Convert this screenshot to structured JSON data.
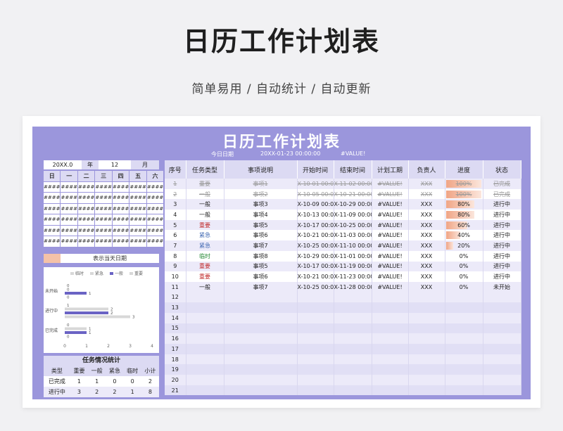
{
  "header": {
    "title": "日历工作计划表",
    "subtitle": "简单易用 / 自动统计 / 自动更新"
  },
  "sheet": {
    "title": "日历工作计划表",
    "today_label": "今日日期",
    "today_value": "20XX-01-23 00:00:00",
    "today_extra": "#VALUE!"
  },
  "calendar": {
    "year": "20XX.0",
    "year_label": "年",
    "month": "12",
    "month_label": "月",
    "weekdays": [
      "日",
      "一",
      "二",
      "三",
      "四",
      "五",
      "六"
    ],
    "cell": "####"
  },
  "legend_today": "表示当天日期",
  "chart_data": {
    "type": "bar",
    "orientation": "horizontal",
    "categories": [
      "未开始",
      "进行中",
      "已完成"
    ],
    "series": [
      {
        "name": "临时",
        "values": [
          0,
          0,
          0
        ],
        "color": "#d8d8d8"
      },
      {
        "name": "紧急",
        "values": [
          0,
          2,
          1
        ],
        "color": "#d8d8d8"
      },
      {
        "name": "一般",
        "values": [
          1,
          2,
          1
        ],
        "color": "#6a63c4"
      },
      {
        "name": "重要",
        "values": [
          0,
          3,
          0
        ],
        "color": "#d8d8d8"
      }
    ],
    "series_labels_order": [
      "临时",
      "紧急",
      "一般",
      "重要"
    ],
    "bar_labels": [
      [
        "0",
        "0",
        "1",
        "0"
      ],
      [
        "1",
        "2",
        "2",
        "3"
      ],
      [
        "0",
        "1",
        "1",
        "0"
      ]
    ],
    "xlim": [
      0,
      4
    ],
    "xticks": [
      "0",
      "1",
      "2",
      "3",
      "4"
    ]
  },
  "stats": {
    "title": "任务情况统计",
    "headers": [
      "类型",
      "重要",
      "一般",
      "紧急",
      "临时",
      "小计"
    ],
    "rows": [
      [
        "已完成",
        "1",
        "1",
        "0",
        "0",
        "2"
      ],
      [
        "进行中",
        "3",
        "2",
        "2",
        "1",
        "8"
      ]
    ]
  },
  "table": {
    "headers": [
      "序号",
      "任务类型",
      "事项说明",
      "开始时间",
      "结束时间",
      "计划工期",
      "负责人",
      "进度",
      "状态"
    ],
    "rows": [
      {
        "no": "1",
        "type": "重要",
        "desc": "事项1",
        "start": "X-10-01 00:00",
        "end": "X-11-02 00:00",
        "dur": "#VALUE!",
        "owner": "XXX",
        "prog": "100%",
        "p": 1.0,
        "status": "已完成",
        "done": true
      },
      {
        "no": "2",
        "type": "一般",
        "desc": "事项2",
        "start": "X-10-05 00:00",
        "end": "X-10-21 00:00",
        "dur": "#VALUE!",
        "owner": "XXX",
        "prog": "100%",
        "p": 1.0,
        "status": "已完成",
        "done": true
      },
      {
        "no": "3",
        "type": "一般",
        "desc": "事项3",
        "start": "X-10-09 00:00",
        "end": "X-10-29 00:00",
        "dur": "#VALUE!",
        "owner": "XXX",
        "prog": "80%",
        "p": 0.8,
        "status": "进行中"
      },
      {
        "no": "4",
        "type": "一般",
        "desc": "事项4",
        "start": "X-10-13 00:00",
        "end": "X-11-09 00:00",
        "dur": "#VALUE!",
        "owner": "XXX",
        "prog": "80%",
        "p": 0.8,
        "status": "进行中"
      },
      {
        "no": "5",
        "type": "重要",
        "desc": "事项5",
        "start": "X-10-17 00:00",
        "end": "X-10-25 00:00",
        "dur": "#VALUE!",
        "owner": "XXX",
        "prog": "60%",
        "p": 0.6,
        "status": "进行中"
      },
      {
        "no": "6",
        "type": "紧急",
        "desc": "事项6",
        "start": "X-10-21 00:00",
        "end": "X-11-03 00:00",
        "dur": "#VALUE!",
        "owner": "XXX",
        "prog": "40%",
        "p": 0.4,
        "status": "进行中"
      },
      {
        "no": "7",
        "type": "紧急",
        "desc": "事项7",
        "start": "X-10-25 00:00",
        "end": "X-11-10 00:00",
        "dur": "#VALUE!",
        "owner": "XXX",
        "prog": "20%",
        "p": 0.2,
        "status": "进行中"
      },
      {
        "no": "8",
        "type": "临时",
        "desc": "事项8",
        "start": "X-10-29 00:00",
        "end": "X-11-01 00:00",
        "dur": "#VALUE!",
        "owner": "XXX",
        "prog": "0%",
        "p": 0,
        "status": "进行中"
      },
      {
        "no": "9",
        "type": "重要",
        "desc": "事项5",
        "start": "X-10-17 00:00",
        "end": "X-11-19 00:00",
        "dur": "#VALUE!",
        "owner": "XXX",
        "prog": "0%",
        "p": 0,
        "status": "进行中"
      },
      {
        "no": "10",
        "type": "重要",
        "desc": "事项6",
        "start": "X-10-21 00:00",
        "end": "X-11-23 00:00",
        "dur": "#VALUE!",
        "owner": "XXX",
        "prog": "0%",
        "p": 0,
        "status": "进行中"
      },
      {
        "no": "11",
        "type": "一般",
        "desc": "事项7",
        "start": "X-10-25 00:00",
        "end": "X-11-28 00:00",
        "dur": "#VALUE!",
        "owner": "XXX",
        "prog": "0%",
        "p": 0,
        "status": "未开始"
      }
    ],
    "empty_rows": [
      "12",
      "13",
      "14",
      "15",
      "16",
      "17",
      "18",
      "19",
      "20",
      "21"
    ]
  },
  "colors": {
    "sheet_bg": "#9b96dc",
    "header_bg": "#dcdaf3",
    "important": "#c0292b",
    "urgent": "#3b64b0",
    "temp": "#2a8a3a",
    "progress": "#f0a585"
  }
}
